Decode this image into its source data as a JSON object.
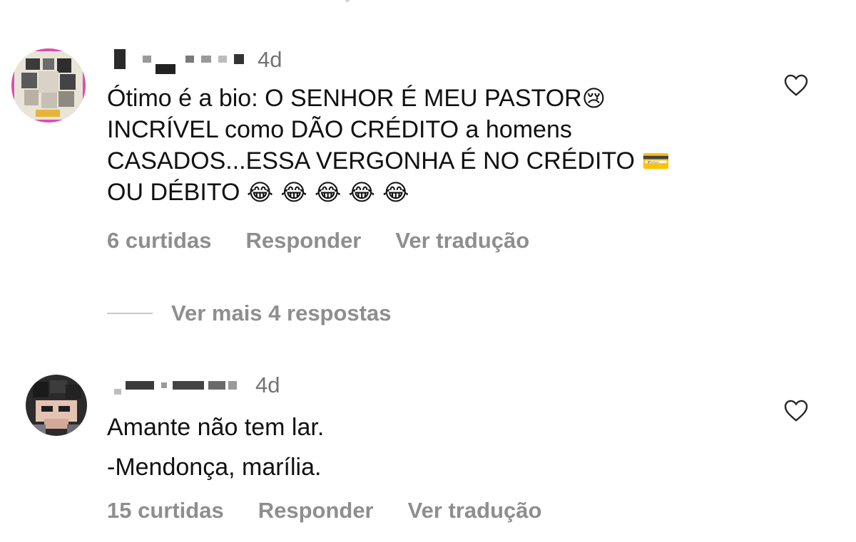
{
  "comments": [
    {
      "time": "4d",
      "text_lines": [
        "Ótimo é a bio: O SENHOR É MEU PASTOR",
        "INCRÍVEL como DÃO CRÉDITO a homens",
        "CASADOS...ESSA VERGONHA É NO CRÉDITO",
        "OU DÉBITO"
      ],
      "emojis": {
        "line1": "😢",
        "line3": "💳",
        "line4": "😂 😂 😂 😂 😂"
      },
      "likes": "6 curtidas",
      "reply": "Responder",
      "translate": "Ver tradução",
      "like_icon": "heart-outline-icon"
    },
    {
      "time": "4d",
      "text_lines": [
        "Amante não tem lar.",
        "-Mendonça, marília."
      ],
      "likes": "15 curtidas",
      "reply": "Responder",
      "translate": "Ver tradução",
      "like_icon": "heart-outline-icon"
    }
  ],
  "view_more_replies": "Ver mais 4 respostas",
  "colors": {
    "text": "#111111",
    "secondary": "#8e8e8e",
    "timestamp": "#737373",
    "divider": "#c7c7c7"
  }
}
